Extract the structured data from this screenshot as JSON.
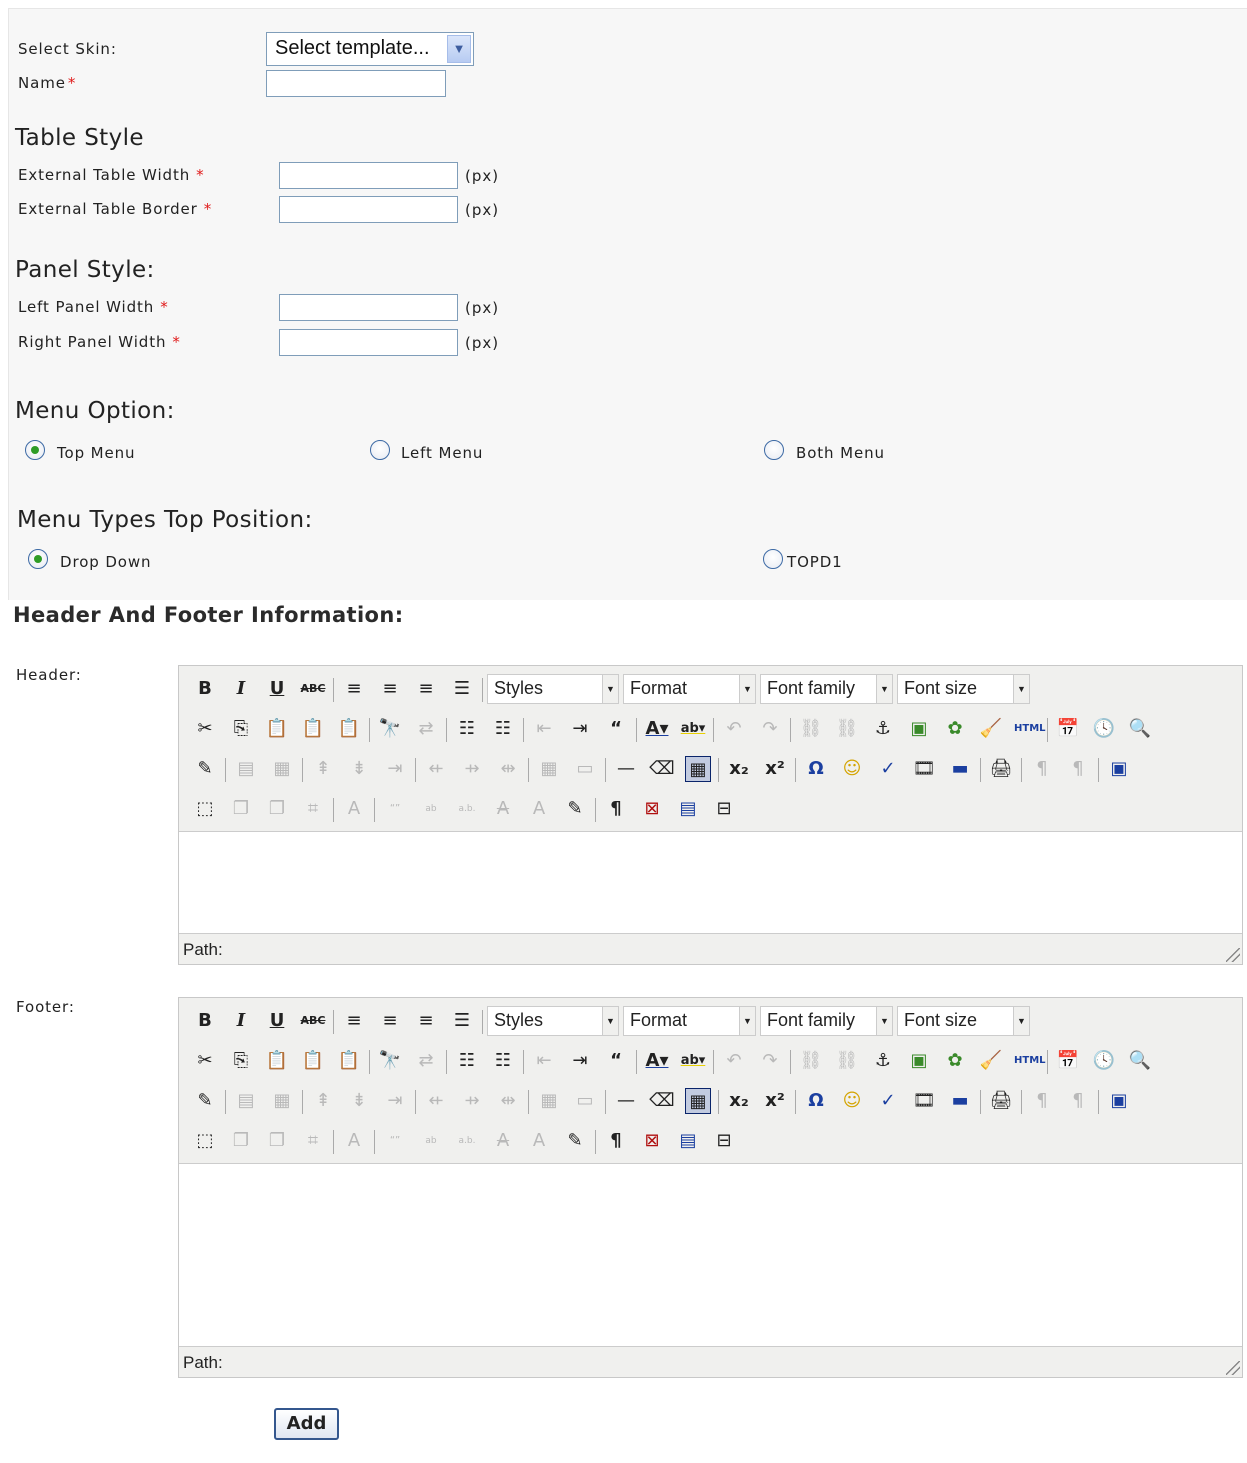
{
  "form": {
    "skin_label": "Select Skin:",
    "skin_value": "Select template...",
    "name_label": "Name",
    "required_mark": "*"
  },
  "table_style": {
    "heading": "Table Style",
    "ext_width_label": "External Table Width",
    "ext_border_label": "External Table Border",
    "unit": "(px)"
  },
  "panel_style": {
    "heading": "Panel Style:",
    "left_label": "Left Panel Width",
    "right_label": "Right Panel Width",
    "unit": "(px)"
  },
  "menu_option": {
    "heading": "Menu Option:",
    "options": [
      {
        "label": "Top Menu",
        "checked": true
      },
      {
        "label": "Left Menu",
        "checked": false
      },
      {
        "label": "Both Menu",
        "checked": false
      }
    ]
  },
  "menu_types": {
    "heading": "Menu Types Top Position:",
    "options": [
      {
        "label": "Drop Down",
        "checked": true
      },
      {
        "label": "TOPD1",
        "checked": false
      }
    ]
  },
  "header_footer": {
    "heading": "Header And Footer Information:",
    "header_label": "Header:",
    "footer_label": "Footer:"
  },
  "editor": {
    "dropdowns": [
      "Styles",
      "Format",
      "Font family",
      "Font size"
    ],
    "path_label": "Path:",
    "html_button": "HTML"
  },
  "actions": {
    "add_label": "Add"
  }
}
